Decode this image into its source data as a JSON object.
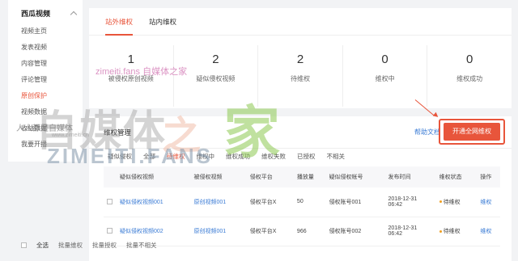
{
  "sidebar": {
    "title": "西瓜视频",
    "items": [
      {
        "label": "视频主页"
      },
      {
        "label": "发表视频"
      },
      {
        "label": "内容管理"
      },
      {
        "label": "评论管理"
      },
      {
        "label": "原创保护"
      },
      {
        "label": "视频数据"
      },
      {
        "label": "收益数据"
      },
      {
        "label": "我要开播"
      }
    ]
  },
  "tabs": [
    "站外维权",
    "站内维权"
  ],
  "stats": [
    {
      "value": "1",
      "label": "被侵权原创视频"
    },
    {
      "value": "2",
      "label": "疑似侵权视频"
    },
    {
      "value": "2",
      "label": "待维权"
    },
    {
      "value": "0",
      "label": "维权中"
    },
    {
      "value": "0",
      "label": "维权成功"
    }
  ],
  "management": {
    "title": "维权管理",
    "help_link": "帮助文档",
    "primary_button": "开通全网维权"
  },
  "filters": [
    "疑似侵权",
    "全部",
    "待维权",
    "维权中",
    "维权成功",
    "维权失败",
    "已授权",
    "不相关"
  ],
  "table": {
    "headers": [
      "疑似侵权视频",
      "被侵权视频",
      "侵权平台",
      "播放量",
      "疑似侵权帐号",
      "发布时间",
      "维权状态",
      "操作"
    ],
    "rows": [
      {
        "suspect": "疑似侵权视频001",
        "original": "原创视频001",
        "platform": "侵权平台X",
        "plays": "50",
        "account": "侵权账号001",
        "date": "2018-12-31",
        "time": "06:42",
        "status": "待维权",
        "action": "维权"
      },
      {
        "suspect": "疑似侵权视频002",
        "original": "原创视频001",
        "platform": "侵权平台X",
        "plays": "966",
        "account": "侵权账号002",
        "date": "2018-12-31",
        "time": "06:42",
        "status": "待维权",
        "action": "维权"
      }
    ]
  },
  "footer": {
    "select_all": "全选",
    "batch_protect": "批量维权",
    "batch_authorize": "批量授权",
    "batch_irrelevant": "批量不相关"
  },
  "watermark": {
    "big": "自媒体",
    "zhi": "之",
    "jia": "家",
    "sub": "ZIMEITI.FANS",
    "slogan": "人人都是自媒体",
    "url": "www.zimeiti.cn",
    "pink": "zimeiti.fans 自媒体之家"
  },
  "colors": {
    "accent": "#e8553b",
    "link": "#3a7bd5"
  }
}
